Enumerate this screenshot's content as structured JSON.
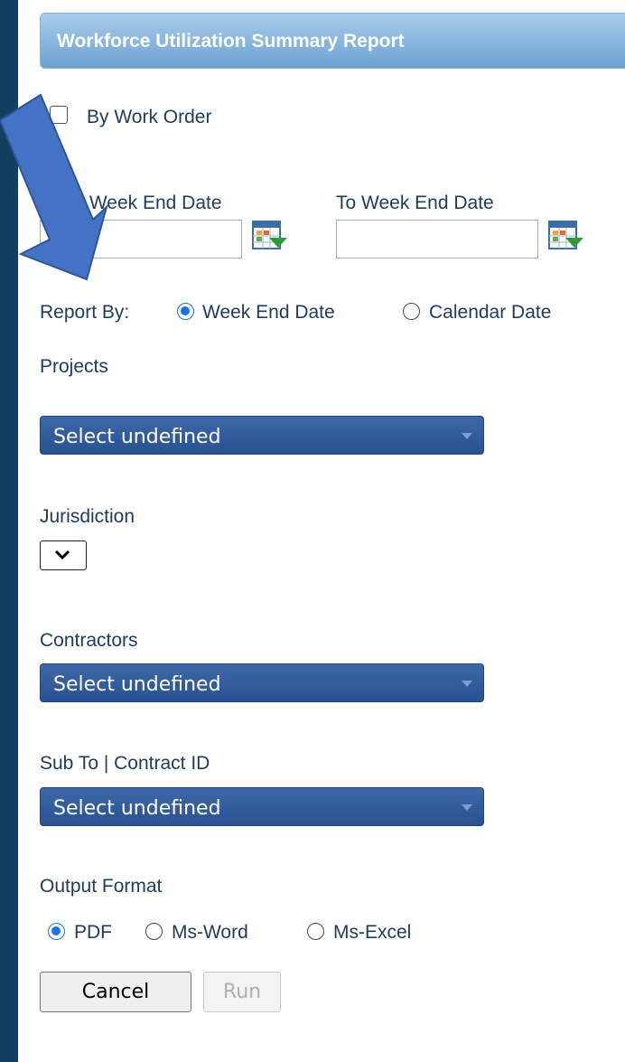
{
  "header": {
    "title": "Workforce Utilization Summary Report"
  },
  "filters": {
    "by_work_order": {
      "label": "By Work Order",
      "checked": false
    },
    "from_week_end_date": {
      "label": "From Week End Date",
      "value": ""
    },
    "to_week_end_date": {
      "label": "To Week End Date",
      "value": ""
    },
    "report_by": {
      "label": "Report By:",
      "options": [
        "Week End Date",
        "Calendar Date"
      ],
      "selected": "Week End Date"
    },
    "projects": {
      "label": "Projects",
      "value": "Select undefined"
    },
    "jurisdiction": {
      "label": "Jurisdiction",
      "value": ""
    },
    "contractors": {
      "label": "Contractors",
      "value": "Select undefined"
    },
    "sub_to": {
      "label": "Sub To | Contract ID",
      "value": "Select undefined"
    },
    "output_format": {
      "label": "Output Format",
      "options": [
        "PDF",
        "Ms-Word",
        "Ms-Excel"
      ],
      "selected": "PDF"
    }
  },
  "buttons": {
    "cancel": "Cancel",
    "run": "Run"
  },
  "icons": {
    "calendar": "calendar-icon",
    "arrow": "arrow-down-right-icon"
  },
  "colors": {
    "sidebar": "#123e61",
    "select_bg": "#2f5597",
    "radio_accent": "#1a73e8",
    "arrow": "#4472c4"
  }
}
